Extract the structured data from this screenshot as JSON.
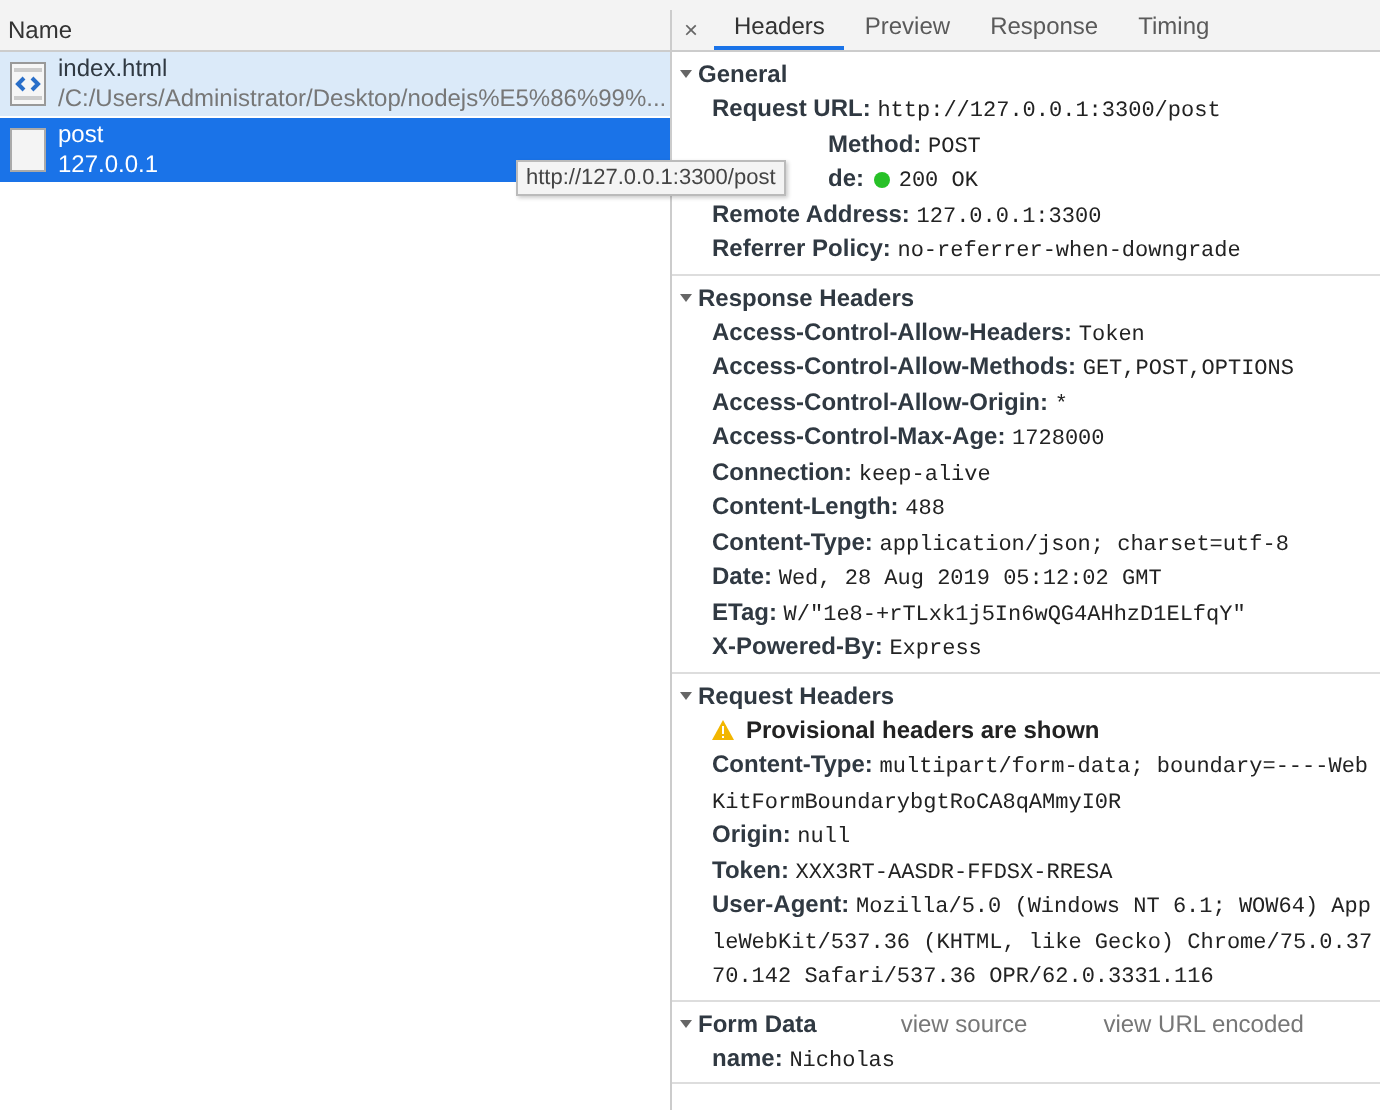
{
  "requests": {
    "column": "Name",
    "rows": [
      {
        "kind": "html",
        "name": "index.html",
        "path": "/C:/Users/Administrator/Desktop/nodejs%E5%86%99%...",
        "selected": false
      },
      {
        "kind": "blank",
        "name": "post",
        "path": "127.0.0.1",
        "selected": true
      }
    ],
    "tooltip": "http://127.0.0.1:3300/post"
  },
  "details": {
    "close": "×",
    "tabs": [
      {
        "label": "Headers",
        "selected": true
      },
      {
        "label": "Preview",
        "selected": false
      },
      {
        "label": "Response",
        "selected": false
      },
      {
        "label": "Timing",
        "selected": false
      }
    ],
    "sections": [
      {
        "title": "General",
        "expanded": true,
        "rows": [
          {
            "kind": "header",
            "name": "Request URL:",
            "value": "http://127.0.0.1:3300/post"
          },
          {
            "kind": "partial",
            "name": "Method:",
            "value": "POST"
          },
          {
            "kind": "partial-status",
            "name": "de:",
            "value": "200 OK",
            "color": "#27c127"
          },
          {
            "kind": "header",
            "name": "Remote Address:",
            "value": "127.0.0.1:3300"
          },
          {
            "kind": "header",
            "name": "Referrer Policy:",
            "value": "no-referrer-when-downgrade"
          }
        ]
      },
      {
        "title": "Response Headers",
        "expanded": true,
        "rows": [
          {
            "kind": "header",
            "name": "Access-Control-Allow-Headers:",
            "value": "Token"
          },
          {
            "kind": "header",
            "name": "Access-Control-Allow-Methods:",
            "value": "GET,POST,OPTIONS"
          },
          {
            "kind": "header",
            "name": "Access-Control-Allow-Origin:",
            "value": "*"
          },
          {
            "kind": "header",
            "name": "Access-Control-Max-Age:",
            "value": "1728000"
          },
          {
            "kind": "header",
            "name": "Connection:",
            "value": "keep-alive"
          },
          {
            "kind": "header",
            "name": "Content-Length:",
            "value": "488"
          },
          {
            "kind": "header",
            "name": "Content-Type:",
            "value": "application/json; charset=utf-8"
          },
          {
            "kind": "header",
            "name": "Date:",
            "value": "Wed, 28 Aug 2019 05:12:02 GMT"
          },
          {
            "kind": "header",
            "name": "ETag:",
            "value": "W/\"1e8-+rTLxk1j5In6wQG4AHhzD1ELfqY\""
          },
          {
            "kind": "header",
            "name": "X-Powered-By:",
            "value": "Express"
          }
        ]
      },
      {
        "title": "Request Headers",
        "expanded": true,
        "rows": [
          {
            "kind": "warning",
            "text": "Provisional headers are shown"
          },
          {
            "kind": "header",
            "name": "Content-Type:",
            "value": "multipart/form-data; boundary=----WebKitFormBoundarybgtRoCA8qAMmyI0R"
          },
          {
            "kind": "header",
            "name": "Origin:",
            "value": "null"
          },
          {
            "kind": "header",
            "name": "Token:",
            "value": "XXX3RT-AASDR-FFDSX-RRESA"
          },
          {
            "kind": "header",
            "name": "User-Agent:",
            "value": "Mozilla/5.0 (Windows NT 6.1; WOW64) AppleWebKit/537.36 (KHTML, like Gecko) Chrome/75.0.3770.142 Safari/537.36 OPR/62.0.3331.116"
          }
        ]
      },
      {
        "title": "Form Data",
        "expanded": true,
        "links": [
          "view source",
          "view URL encoded"
        ],
        "rows": [
          {
            "kind": "header",
            "name": "name:",
            "value": "Nicholas"
          }
        ]
      }
    ]
  }
}
